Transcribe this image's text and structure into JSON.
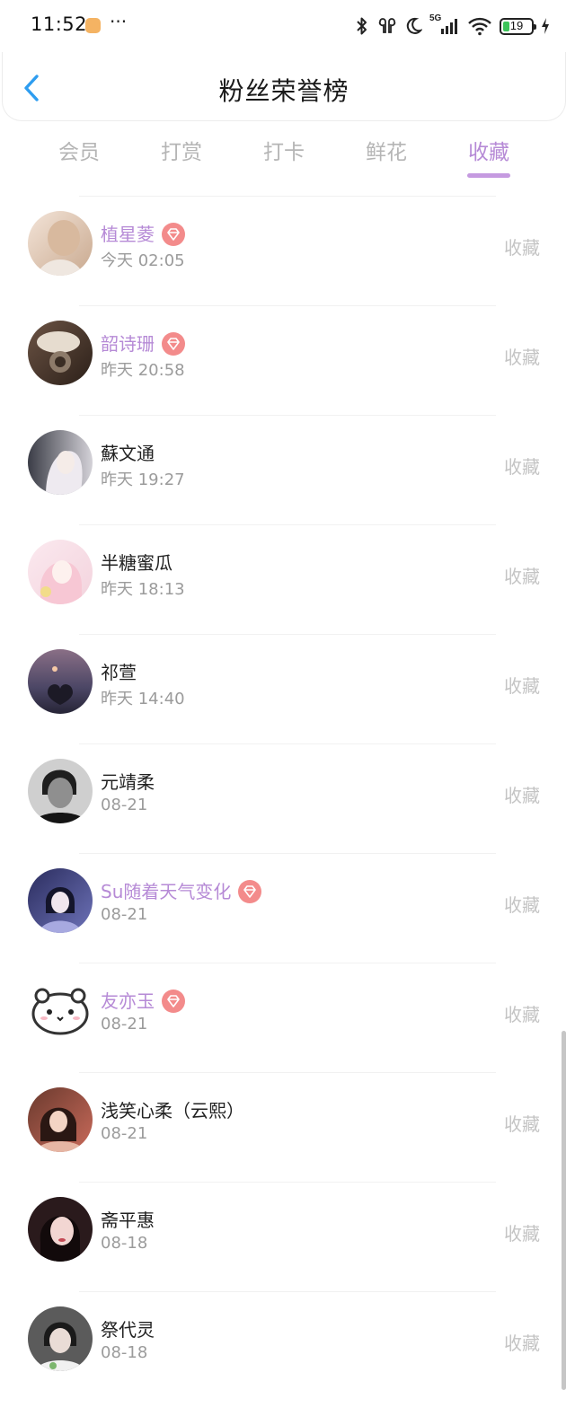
{
  "status": {
    "time": "11:52",
    "dots": "···",
    "network": "5G",
    "battery": "19",
    "icons": [
      "app-notification-icon",
      "bluetooth-icon",
      "earbuds-icon",
      "moon-icon",
      "signal-icon",
      "wifi-icon",
      "battery-icon",
      "charging-icon"
    ]
  },
  "header": {
    "title": "粉丝荣誉榜",
    "back_icon": "chevron-left-icon"
  },
  "tabs": [
    {
      "label": "会员",
      "active": false
    },
    {
      "label": "打赏",
      "active": false
    },
    {
      "label": "打卡",
      "active": false
    },
    {
      "label": "鲜花",
      "active": false
    },
    {
      "label": "收藏",
      "active": true
    }
  ],
  "fans": [
    {
      "name": "植星菱",
      "time": "今天 02:05",
      "vip": true,
      "action": "收藏"
    },
    {
      "name": "韶诗珊",
      "time": "昨天 20:58",
      "vip": true,
      "action": "收藏"
    },
    {
      "name": "蘇文通",
      "time": "昨天 19:27",
      "vip": false,
      "action": "收藏"
    },
    {
      "name": "半糖蜜瓜",
      "time": "昨天 18:13",
      "vip": false,
      "action": "收藏"
    },
    {
      "name": "祁萱",
      "time": "昨天 14:40",
      "vip": false,
      "action": "收藏"
    },
    {
      "name": "元靖柔",
      "time": "08-21",
      "vip": false,
      "action": "收藏"
    },
    {
      "name": "Su随着天气变化",
      "time": "08-21",
      "vip": true,
      "action": "收藏"
    },
    {
      "name": "友亦玉",
      "time": "08-21",
      "vip": true,
      "action": "收藏"
    },
    {
      "name": "浅笑心柔（云熙）",
      "time": "08-21",
      "vip": false,
      "action": "收藏"
    },
    {
      "name": "斋平惠",
      "time": "08-18",
      "vip": false,
      "action": "收藏"
    },
    {
      "name": "祭代灵",
      "time": "08-18",
      "vip": false,
      "action": "收藏"
    }
  ],
  "colors": {
    "accent": "#b68ad6",
    "vip_badge": "#f38b8b",
    "back_icon": "#2e9df0",
    "inactive_tab": "#b5b5b5",
    "action_text": "#c4c4c4"
  }
}
